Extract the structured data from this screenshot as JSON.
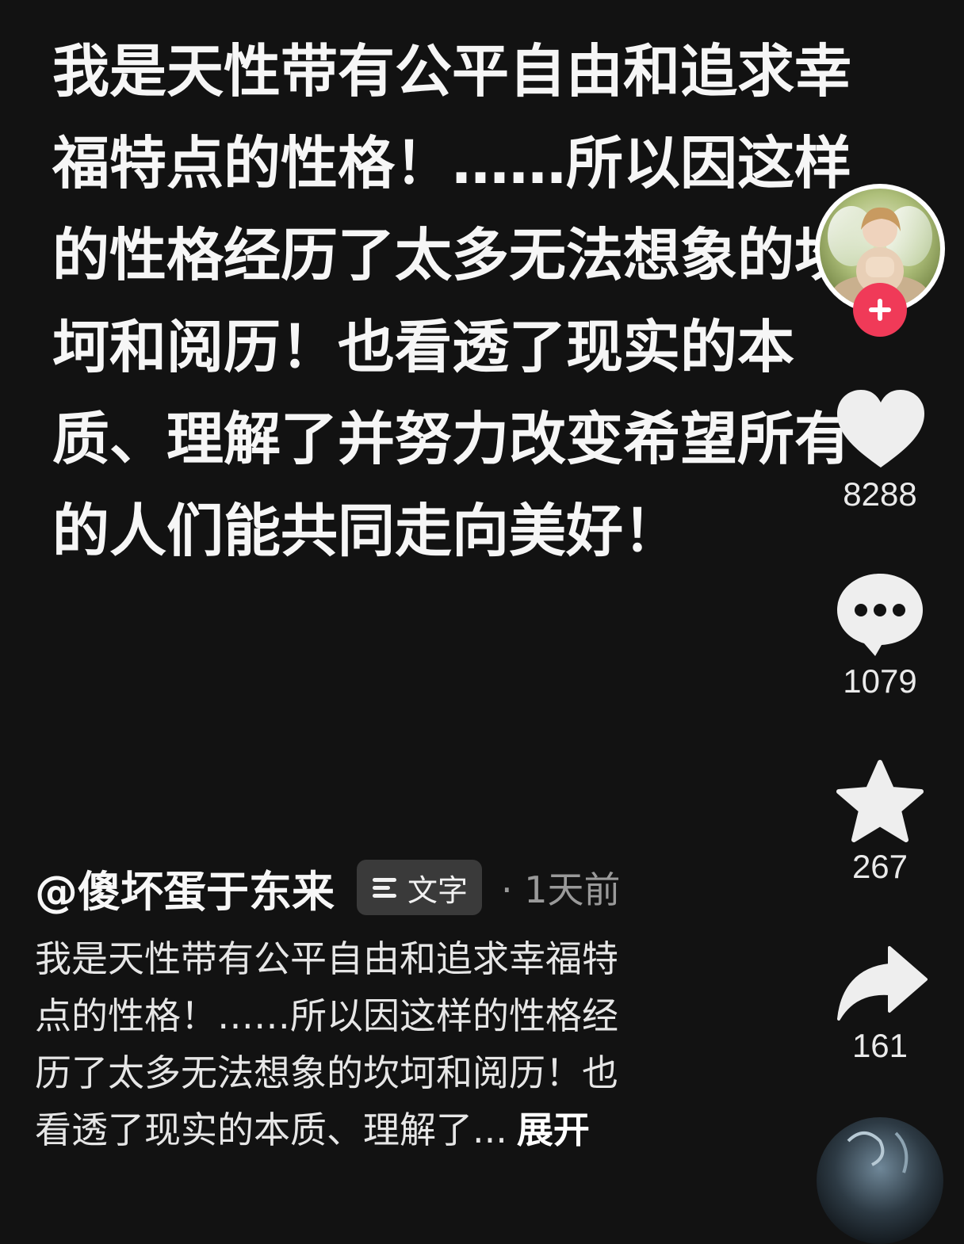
{
  "overlay_text": {
    "lines": [
      "我是天性带有公平自由和追求幸",
      "福特点的性格！……所以因这样",
      "的性格经历了太多无法想象的坎",
      "坷和阅历！也看透了现实的本",
      "质、理解了并努力改变希望所有",
      "的人们能共同走向美好！"
    ]
  },
  "rail": {
    "avatar_icon": "user-avatar",
    "follow_icon": "plus-icon",
    "like": {
      "icon": "heart-icon",
      "count": "8288"
    },
    "comment": {
      "icon": "comment-icon",
      "count": "1079"
    },
    "favorite": {
      "icon": "star-icon",
      "count": "267"
    },
    "share": {
      "icon": "share-icon",
      "count": "161"
    }
  },
  "post": {
    "author": "@傻坏蛋于东来",
    "tag_label": "文字",
    "time": "· 1天前",
    "description_lines": [
      "我是天性带有公平自由和追求幸福特",
      "点的性格！……所以因这样的性格经",
      "历了太多无法想象的坎坷和阅历！也",
      "看透了现实的本质、理解了..."
    ],
    "expand_label": "展开"
  },
  "colors": {
    "background": "#121212",
    "follow_button": "#f03a58",
    "tag_background": "#3a3a3a",
    "icon_fill": "#eeeeee"
  }
}
